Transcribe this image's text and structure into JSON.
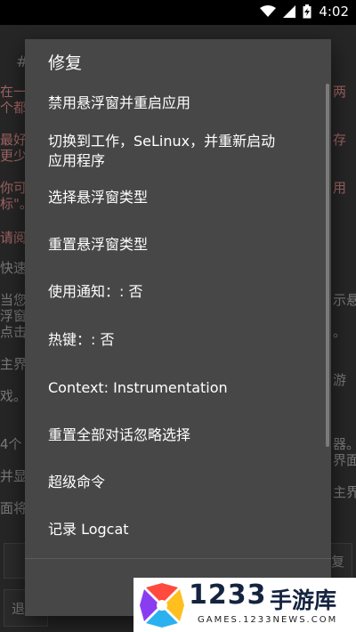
{
  "status": {
    "time": "4:02",
    "wifi_icon": "wifi-icon",
    "signal_icon": "signal-icon",
    "battery_icon": "battery-charging-icon"
  },
  "background": {
    "lines": [
      "#",
      "在一",
      "两",
      "个都",
      "最好",
      "存",
      "更少",
      "你可",
      "用",
      "标\"。",
      "请阅",
      "快速",
      "当您",
      "示悬",
      "浮窗",
      "点击",
      "。",
      "主界",
      "游",
      "戏。",
      "4个",
      "器。",
      "并显",
      "界面",
      "主界",
      "面将"
    ],
    "buttons": {
      "left": "退",
      "right": "复"
    }
  },
  "dialog": {
    "title": "修复",
    "items": [
      "禁用悬浮窗并重启应用",
      "切换到工作，SeLinux，并重新启动",
      "应用程序",
      "选择悬浮窗类型",
      "重置悬浮窗类型",
      "使用通知：: 否",
      "热键：: 否",
      "Context: Instrumentation",
      "重置全部对话忽略选择",
      "超级命令",
      "记录 Logcat"
    ]
  },
  "watermark": {
    "number": "1233",
    "name": "手游库",
    "url": "GAMES.1233NEWS.COM",
    "colors": [
      "#ff4a3d",
      "#ffbf1f",
      "#2ab1f0",
      "#8a3df0"
    ]
  }
}
